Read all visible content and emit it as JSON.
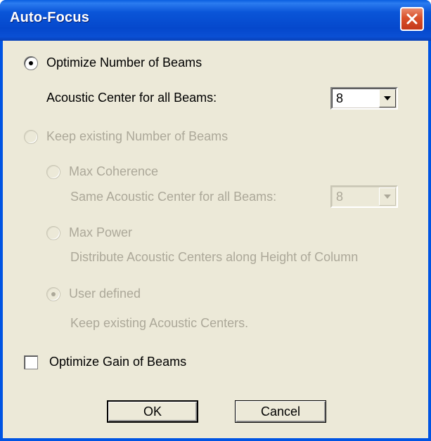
{
  "window": {
    "title": "Auto-Focus"
  },
  "options": {
    "optimize_beams": {
      "label": "Optimize Number of Beams",
      "checked": true,
      "enabled": true
    },
    "acoustic_center_label": "Acoustic Center for all Beams:",
    "acoustic_center_value": "8",
    "keep_beams": {
      "label": "Keep existing Number of Beams",
      "checked": false,
      "enabled": false
    },
    "max_coherence": {
      "label": "Max Coherence",
      "checked": false,
      "enabled": false
    },
    "same_center_label": "Same Acoustic Center for all Beams:",
    "same_center_value": "8",
    "max_power": {
      "label": "Max Power",
      "checked": false,
      "enabled": false
    },
    "distribute_label": "Distribute Acoustic Centers along Height of Column",
    "user_defined": {
      "label": "User defined",
      "checked": true,
      "enabled": false
    },
    "keep_centers_label": "Keep existing Acoustic Centers.",
    "optimize_gain": {
      "label": "Optimize Gain of Beams",
      "checked": false
    }
  },
  "buttons": {
    "ok": "OK",
    "cancel": "Cancel"
  },
  "colors": {
    "titlebar": "#0054e3",
    "face": "#ece9d8",
    "disabled_text": "#aca899",
    "close": "#d9502a"
  }
}
